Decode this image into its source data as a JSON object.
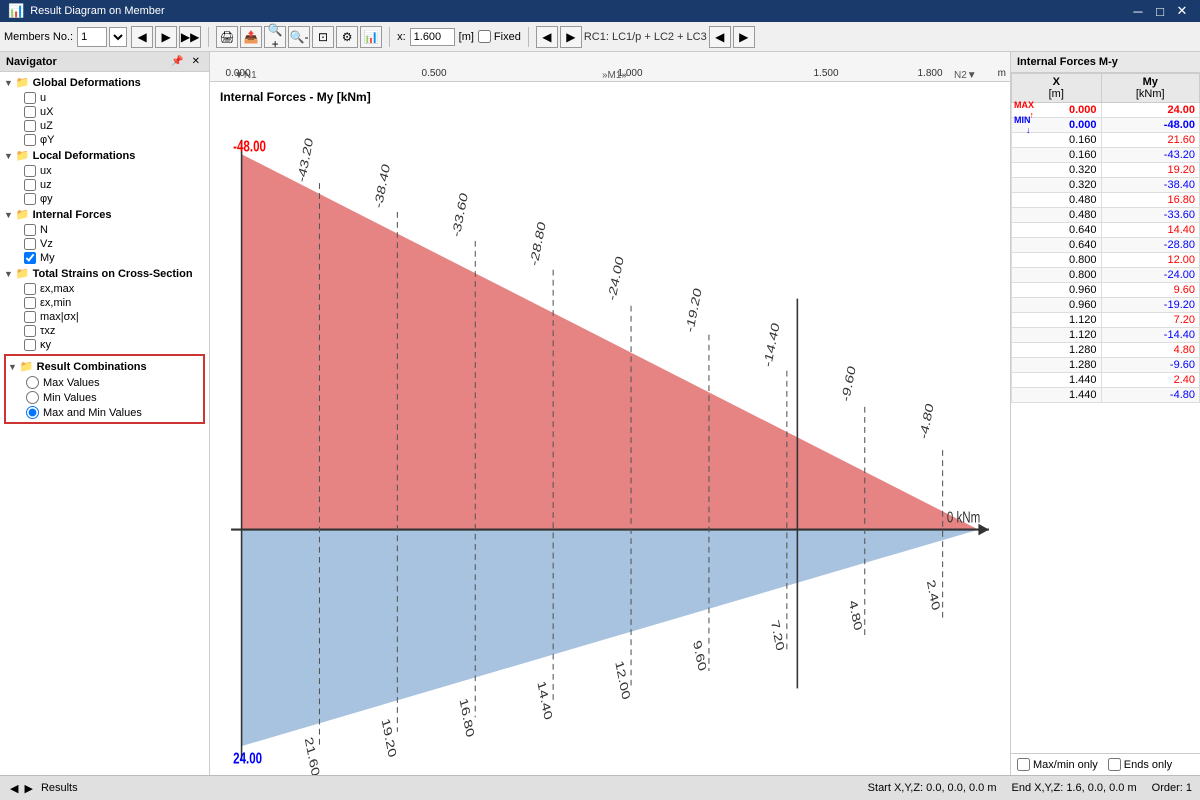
{
  "window": {
    "title": "Result Diagram on Member",
    "icon": "📊"
  },
  "toolbar": {
    "members_label": "Members No.:",
    "member_number": "1",
    "rc_label": "RC1: LC1/p + LC2 + LC3"
  },
  "xcoord": {
    "label": "x:",
    "value": "1.600",
    "unit": "[m]",
    "fixed_label": "Fixed"
  },
  "navigator": {
    "title": "Navigator",
    "groups": [
      {
        "name": "global-deformations",
        "label": "Global Deformations",
        "items": [
          {
            "id": "u",
            "label": "u",
            "checked": false
          },
          {
            "id": "ux",
            "label": "uX",
            "checked": false
          },
          {
            "id": "uz",
            "label": "uZ",
            "checked": false
          },
          {
            "id": "phiy",
            "label": "φY",
            "checked": false
          }
        ]
      },
      {
        "name": "local-deformations",
        "label": "Local Deformations",
        "items": [
          {
            "id": "ux_local",
            "label": "ux",
            "checked": false
          },
          {
            "id": "uz_local",
            "label": "uz",
            "checked": false
          },
          {
            "id": "phiy_local",
            "label": "φy",
            "checked": false
          }
        ]
      },
      {
        "name": "internal-forces",
        "label": "Internal Forces",
        "items": [
          {
            "id": "N",
            "label": "N",
            "checked": false
          },
          {
            "id": "Vz",
            "label": "Vz",
            "checked": false
          },
          {
            "id": "My",
            "label": "My",
            "checked": true
          }
        ]
      },
      {
        "name": "total-strains",
        "label": "Total Strains on Cross-Section",
        "items": [
          {
            "id": "ex_max",
            "label": "εx,max",
            "checked": false
          },
          {
            "id": "ex_min",
            "label": "εx,min",
            "checked": false
          },
          {
            "id": "max_sx",
            "label": "max|σx|",
            "checked": false
          },
          {
            "id": "txz",
            "label": "τxz",
            "checked": false
          },
          {
            "id": "ky",
            "label": "κy",
            "checked": false
          }
        ]
      }
    ],
    "result_combinations": {
      "label": "Result Combinations",
      "options": [
        {
          "id": "max_values",
          "label": "Max Values",
          "checked": false
        },
        {
          "id": "min_values",
          "label": "Min Values",
          "checked": false
        },
        {
          "id": "max_min_values",
          "label": "Max and Min Values",
          "checked": true
        }
      ]
    }
  },
  "chart": {
    "title": "Internal Forces - My [kNm]",
    "ruler": {
      "marks": [
        {
          "value": "0.000",
          "pos_pct": 3.5
        },
        {
          "value": "0.500",
          "pos_pct": 28
        },
        {
          "value": "1.000",
          "pos_pct": 52.5
        },
        {
          "value": "1.500",
          "pos_pct": 77
        },
        {
          "value": "1.800",
          "pos_pct": 92
        }
      ],
      "unit": "m",
      "nodes": [
        {
          "label": "N1",
          "pos_pct": 3.5
        },
        {
          "label": "M1»",
          "pos_pct": 52.5
        },
        {
          "label": "N2",
          "pos_pct": 96
        }
      ]
    },
    "zero_label": "0 kNm",
    "positive_values": [
      "-48.00",
      "-43.20",
      "-38.40",
      "-33.60",
      "-28.80",
      "-24.00",
      "-19.20",
      "-14.40",
      "-9.60",
      "-4.80"
    ],
    "negative_values": [
      "24.00",
      "21.60",
      "19.20",
      "16.80",
      "14.40",
      "12.00",
      "9.60",
      "7.20",
      "4.80",
      "2.40"
    ]
  },
  "right_panel": {
    "title": "Internal Forces M-y",
    "col_x": "X\n[m]",
    "col_my": "My\n[kNm]",
    "max_label": "MAX",
    "min_label": "MIN",
    "rows": [
      {
        "x": "0.000",
        "my": "24.00",
        "type": "max"
      },
      {
        "x": "0.000",
        "my": "-48.00",
        "type": "min"
      },
      {
        "x": "0.160",
        "my": "21.60",
        "type": "normal"
      },
      {
        "x": "0.160",
        "my": "-43.20",
        "type": "normal"
      },
      {
        "x": "0.320",
        "my": "19.20",
        "type": "normal"
      },
      {
        "x": "0.320",
        "my": "-38.40",
        "type": "normal"
      },
      {
        "x": "0.480",
        "my": "16.80",
        "type": "normal"
      },
      {
        "x": "0.480",
        "my": "-33.60",
        "type": "normal"
      },
      {
        "x": "0.640",
        "my": "14.40",
        "type": "normal"
      },
      {
        "x": "0.640",
        "my": "-28.80",
        "type": "normal"
      },
      {
        "x": "0.800",
        "my": "12.00",
        "type": "normal"
      },
      {
        "x": "0.800",
        "my": "-24.00",
        "type": "normal"
      },
      {
        "x": "0.960",
        "my": "9.60",
        "type": "normal"
      },
      {
        "x": "0.960",
        "my": "-19.20",
        "type": "normal"
      },
      {
        "x": "1.120",
        "my": "7.20",
        "type": "normal"
      },
      {
        "x": "1.120",
        "my": "-14.40",
        "type": "normal"
      },
      {
        "x": "1.280",
        "my": "4.80",
        "type": "normal"
      },
      {
        "x": "1.280",
        "my": "-9.60",
        "type": "normal"
      },
      {
        "x": "1.440",
        "my": "2.40",
        "type": "normal"
      },
      {
        "x": "1.440",
        "my": "-4.80",
        "type": "normal"
      }
    ],
    "footer": {
      "max_min_only": "Max/min only",
      "ends_only": "Ends only"
    }
  },
  "status": {
    "section_label": "Results",
    "start": "Start X,Y,Z:  0.0, 0.0, 0.0 m",
    "end": "End X,Y,Z:  1.6, 0.0, 0.0 m",
    "order": "Order: 1"
  }
}
